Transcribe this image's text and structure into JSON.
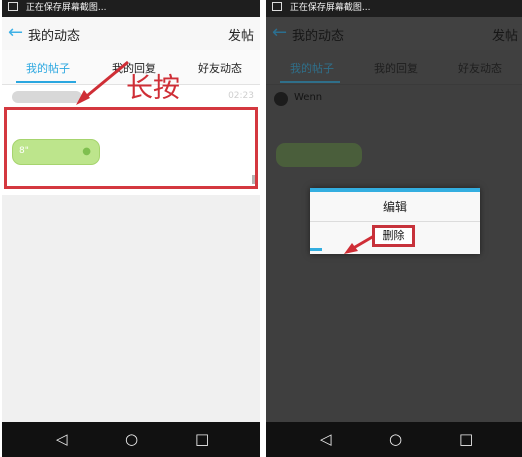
{
  "status_text": "正在保存屏幕截图...",
  "header": {
    "title": "我的动态",
    "post_label": "发帖"
  },
  "tabs": [
    {
      "label": "我的帖子"
    },
    {
      "label": "我的回复"
    },
    {
      "label": "好友动态"
    }
  ],
  "post": {
    "time": "02:23",
    "voice_duration": "8\"",
    "username": "Wenn"
  },
  "annotation": "长按",
  "dialog": {
    "edit_label": "编辑",
    "delete_label": "删除"
  },
  "colors": {
    "accent": "#2ba7e0",
    "highlight": "#d4383f",
    "voice_bubble": "#bde58c"
  },
  "nav": {
    "back": "◁",
    "home": "○",
    "recent": "□"
  }
}
